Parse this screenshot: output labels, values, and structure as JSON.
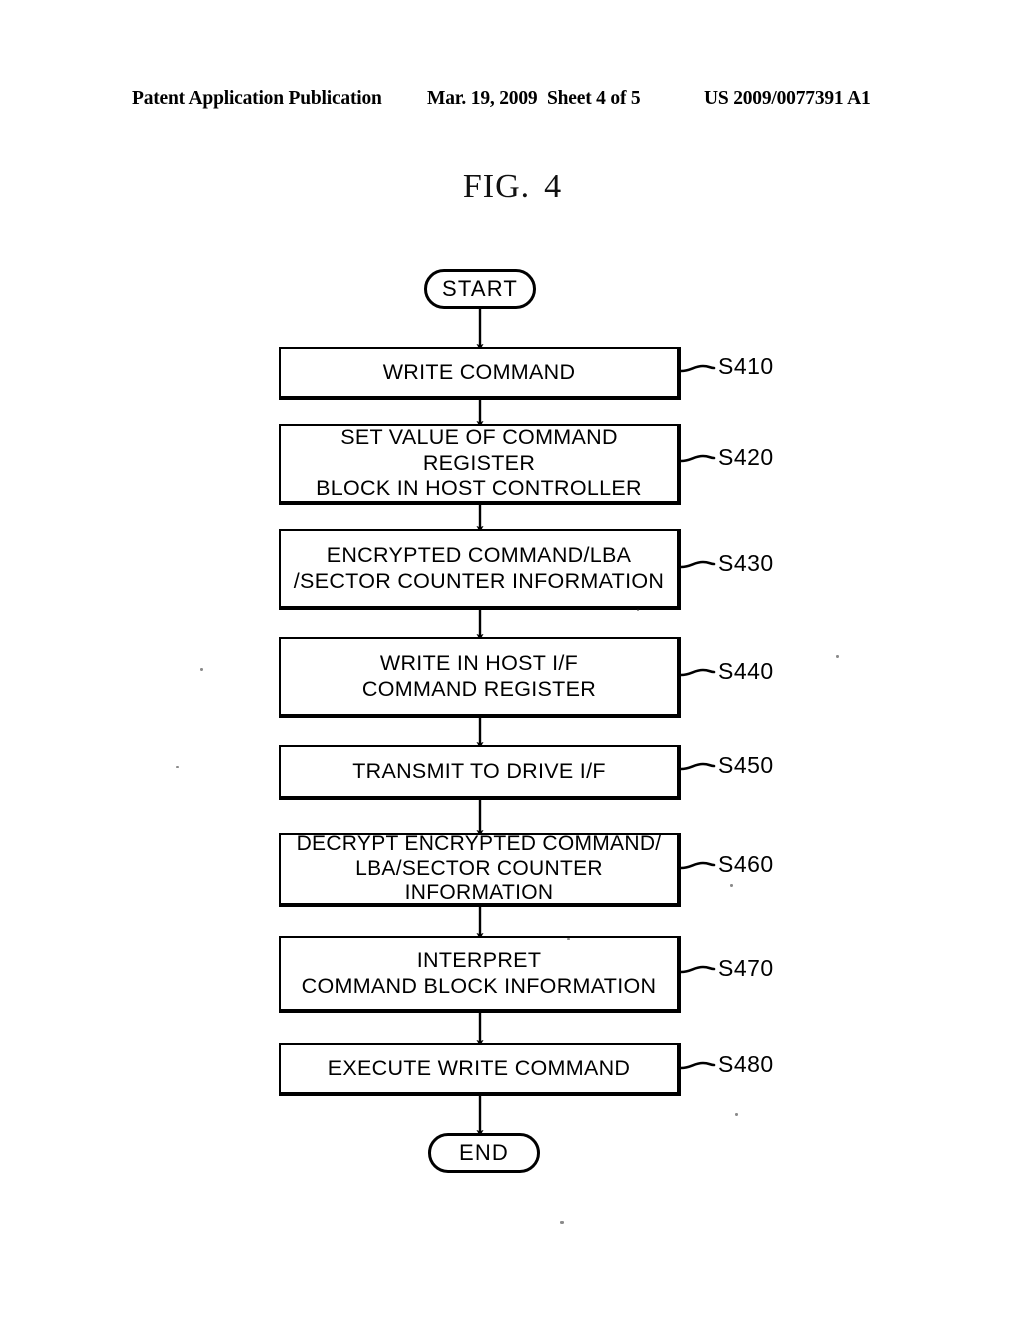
{
  "header": {
    "publication": "Patent Application Publication",
    "date": "Mar. 19, 2009",
    "sheet": "Sheet 4 of 5",
    "patent_number": "US 2009/0077391 A1"
  },
  "figure": {
    "label": "FIG.",
    "number": "4"
  },
  "flowchart": {
    "start_label": "START",
    "end_label": "END",
    "steps": [
      {
        "id": "S410",
        "text": "WRITE COMMAND"
      },
      {
        "id": "S420",
        "line1": "SET VALUE OF COMMAND REGISTER",
        "line2": "BLOCK IN HOST CONTROLLER"
      },
      {
        "id": "S430",
        "line1": "ENCRYPTED COMMAND/LBA",
        "line2": "/SECTOR COUNTER INFORMATION"
      },
      {
        "id": "S440",
        "line1": "WRITE IN HOST I/F",
        "line2": "COMMAND REGISTER"
      },
      {
        "id": "S450",
        "text": "TRANSMIT TO DRIVE I/F"
      },
      {
        "id": "S460",
        "line1": "DECRYPT ENCRYPTED COMMAND/",
        "line2": "LBA/SECTOR COUNTER INFORMATION"
      },
      {
        "id": "S470",
        "line1": "INTERPRET",
        "line2": "COMMAND BLOCK INFORMATION"
      },
      {
        "id": "S480",
        "text": "EXECUTE WRITE COMMAND"
      }
    ]
  },
  "colors": {
    "ink": "#000000",
    "paper": "#ffffff"
  }
}
